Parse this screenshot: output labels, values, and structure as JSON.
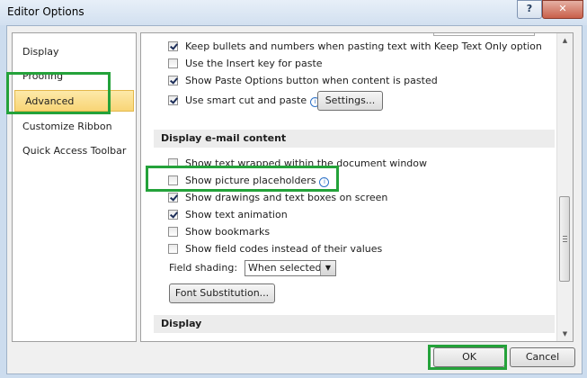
{
  "window": {
    "title": "Editor Options",
    "help_label": "?",
    "close_label": "✕"
  },
  "nav": {
    "items": [
      {
        "label": "Display"
      },
      {
        "label": "Proofing"
      },
      {
        "label": "Advanced",
        "selected": true
      },
      {
        "label": "Customize Ribbon"
      },
      {
        "label": "Quick Access Toolbar"
      }
    ]
  },
  "options": {
    "keep_bullets": {
      "label": "Keep bullets and numbers when pasting text with Keep Text Only option",
      "checked": true
    },
    "insert_key": {
      "label": "Use the Insert key for paste",
      "checked": false
    },
    "paste_options": {
      "label": "Show Paste Options button when content is pasted",
      "checked": true
    },
    "smart_cut": {
      "label": "Use smart cut and paste",
      "checked": true
    },
    "settings_button": "Settings...",
    "section_display_email": "Display e-mail content",
    "text_wrapped": {
      "label": "Show text wrapped within the document window",
      "checked": false
    },
    "picture_placeholders": {
      "label": "Show picture placeholders",
      "checked": false
    },
    "drawings": {
      "label": "Show drawings and text boxes on screen",
      "checked": true
    },
    "text_animation": {
      "label": "Show text animation",
      "checked": true
    },
    "bookmarks": {
      "label": "Show bookmarks",
      "checked": false
    },
    "field_codes": {
      "label": "Show field codes instead of their values",
      "checked": false
    },
    "field_shading_label": "Field shading:",
    "field_shading_value": "When selected",
    "font_substitution": "Font Substitution...",
    "section_display": "Display"
  },
  "footer": {
    "ok": "OK",
    "cancel": "Cancel"
  },
  "colors": {
    "highlight": "#24a23a",
    "selected_nav": "#f8d576"
  }
}
